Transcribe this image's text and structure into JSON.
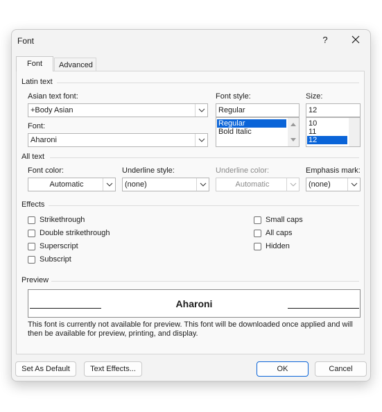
{
  "dialog": {
    "title": "Font",
    "help_glyph": "?",
    "close_glyph": "×"
  },
  "tabs": [
    {
      "label": "Font",
      "active": true
    },
    {
      "label": "Advanced",
      "active": false
    }
  ],
  "latin_text": {
    "group_label": "Latin text",
    "asian_font_label": "Asian text font:",
    "asian_font_value": "+Body Asian",
    "font_label": "Font:",
    "font_value": "Aharoni",
    "font_style_label": "Font style:",
    "font_style_value": "Regular",
    "font_style_options": [
      "Regular",
      "Bold Italic"
    ],
    "font_style_selected": "Regular",
    "size_label": "Size:",
    "size_value": "12",
    "size_options": [
      "10",
      "11",
      "12"
    ],
    "size_selected": "12"
  },
  "all_text": {
    "group_label": "All text",
    "font_color_label": "Font color:",
    "font_color_value": "Automatic",
    "underline_style_label": "Underline style:",
    "underline_style_value": "(none)",
    "underline_color_label": "Underline color:",
    "underline_color_value": "Automatic",
    "emphasis_mark_label": "Emphasis mark:",
    "emphasis_mark_value": "(none)"
  },
  "effects": {
    "group_label": "Effects",
    "left": [
      "Strikethrough",
      "Double strikethrough",
      "Superscript",
      "Subscript"
    ],
    "right": [
      "Small caps",
      "All caps",
      "Hidden"
    ]
  },
  "preview": {
    "group_label": "Preview",
    "sample_text": "Aharoni",
    "note": "This font is currently not available for preview. This font will be downloaded once applied and will then be available for preview, printing, and display."
  },
  "buttons": {
    "set_default": "Set As Default",
    "text_effects": "Text Effects...",
    "ok": "OK",
    "cancel": "Cancel"
  },
  "colors": {
    "accent": "#0a64d8",
    "dialog_bg": "#f3f3f3",
    "panel_bg": "#f9f9f9"
  }
}
